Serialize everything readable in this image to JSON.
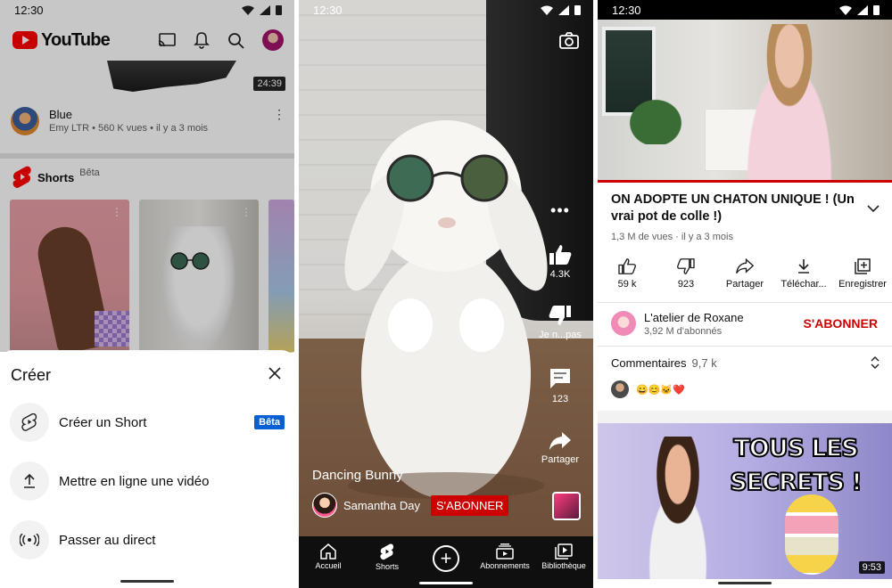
{
  "panel1": {
    "status_time": "12:30",
    "logo_text": "YouTube",
    "video": {
      "duration": "24:39",
      "title": "Blue",
      "meta": "Emy LTR • 560 K vues • il y a 3 mois"
    },
    "shorts": {
      "label": "Shorts",
      "beta": "Bêta"
    },
    "sheet": {
      "title": "Créer",
      "items": [
        {
          "label": "Créer un Short",
          "icon": "shorts-icon",
          "badge": "Bêta"
        },
        {
          "label": "Mettre en ligne une vidéo",
          "icon": "upload-icon"
        },
        {
          "label": "Passer au direct",
          "icon": "live-icon"
        }
      ]
    }
  },
  "panel2": {
    "status_time": "12:30",
    "actions": {
      "like_count": "4.3K",
      "dislike_label": "Je n...pas",
      "comment_count": "123",
      "share_label": "Partager"
    },
    "short_title": "Dancing Bunny",
    "channel_name": "Samantha Day",
    "subscribe_label": "S'ABONNER",
    "nav": [
      {
        "label": "Accueil",
        "icon": "home-icon"
      },
      {
        "label": "Shorts",
        "icon": "shorts-icon"
      },
      {
        "label": "",
        "icon": "create-plus-icon"
      },
      {
        "label": "Abonnements",
        "icon": "subscriptions-icon"
      },
      {
        "label": "Bibliothèque",
        "icon": "library-icon"
      }
    ]
  },
  "panel3": {
    "status_time": "12:30",
    "video_title": "ON ADOPTE UN CHATON UNIQUE ! (Un vrai pot de colle !)",
    "video_meta": "1,3 M de vues  ·  il y a 3 mois",
    "actions": [
      {
        "label": "59 k",
        "icon": "thumbs-up-icon"
      },
      {
        "label": "923",
        "icon": "thumbs-down-icon"
      },
      {
        "label": "Partager",
        "icon": "share-icon"
      },
      {
        "label": "Téléchar...",
        "icon": "download-icon"
      },
      {
        "label": "Enregistrer",
        "icon": "save-playlist-icon"
      }
    ],
    "channel": {
      "name": "L'atelier de Roxane",
      "subs": "3,92 M d'abonnés",
      "subscribe_label": "S'ABONNER"
    },
    "comments": {
      "label": "Commentaires",
      "count": "9,7 k",
      "preview": "😄😊🐱❤️"
    },
    "next_video": {
      "overlay_text": "TOUS LES SECRETS !",
      "duration": "9:53"
    }
  },
  "colors": {
    "brand_red": "#ff0000",
    "subscribe_red": "#cc0000",
    "beta_blue": "#065fd4"
  }
}
